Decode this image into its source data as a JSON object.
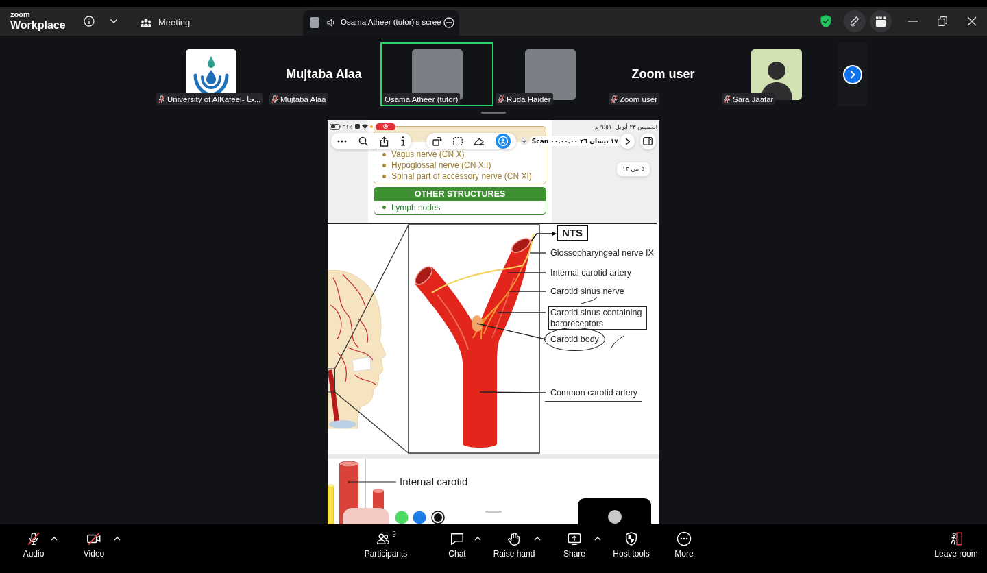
{
  "title_bar": {
    "logo_small": "zoom",
    "logo": "Workplace",
    "tabs": [
      {
        "label": "Meeting",
        "kind": "meeting",
        "selected": false
      },
      {
        "label": "Osama Atheer (tutor)'s scree",
        "kind": "screen_share",
        "selected": true
      }
    ]
  },
  "participants": [
    {
      "kind": "logo",
      "label": "University of AlKafeel- جا...",
      "muted": true,
      "speaking": false
    },
    {
      "kind": "name",
      "display_name": "Mujtaba Alaa",
      "label": "Mujtaba Alaa",
      "muted": true,
      "speaking": false
    },
    {
      "kind": "photo",
      "label": "Osama Atheer (tutor)",
      "muted": false,
      "speaking": true
    },
    {
      "kind": "photo",
      "label": "Ruda Haider",
      "muted": true,
      "speaking": false
    },
    {
      "kind": "name",
      "display_name": "Zoom user",
      "label": "Zoom user",
      "muted": true,
      "speaking": false
    },
    {
      "kind": "avatar",
      "label": "Sara Jaafar",
      "muted": true,
      "speaking": false
    }
  ],
  "shared_screen": {
    "status_bar": {
      "battery": "٦١٪",
      "recording": true,
      "time": "٩:٥١ م",
      "date": "الخميس ٢٣ أبريل"
    },
    "toolbar": {
      "document_title": "Scan ١٧ نيسان ٢٦ ٠٠.٠٠.٠٠",
      "markup_on": true
    },
    "page_indicator": "٥ من ١٣",
    "list_items": [
      "Vagus nerve (CN X)",
      "Hypoglossal nerve (CN XII)",
      "Spinal part of accessory nerve (CN XI)"
    ],
    "other_structures": {
      "title": "OTHER STRUCTURES",
      "items": [
        "Lymph nodes"
      ]
    },
    "diagram": {
      "labels": [
        {
          "text": "NTS",
          "kind": "framed"
        },
        {
          "text": "Glossopharyngeal nerve IX",
          "kind": "plain"
        },
        {
          "text": "Internal carotid artery",
          "kind": "plain"
        },
        {
          "text": "Carotid sinus nerve",
          "kind": "plain"
        },
        {
          "text": "Carotid sinus containing baroreceptors",
          "kind": "boxed"
        },
        {
          "text": "Carotid body",
          "kind": "circled"
        },
        {
          "text": "Common carotid artery",
          "kind": "underlined"
        }
      ]
    },
    "second_figure": {
      "label": "Internal carotid"
    },
    "pen_colors": [
      {
        "color": "#4cd964",
        "selected": false
      },
      {
        "color": "#1e7ce6",
        "selected": false
      },
      {
        "color": "#111111",
        "selected": true
      }
    ]
  },
  "toolbar": {
    "media": [
      {
        "label": "Audio",
        "kind": "audio",
        "muted": true,
        "menu": true
      },
      {
        "label": "Video",
        "kind": "video",
        "muted": true,
        "menu": true
      }
    ],
    "controls": [
      {
        "label": "Participants",
        "kind": "participants",
        "count": "9",
        "menu": false
      },
      {
        "label": "Chat",
        "kind": "chat",
        "menu": true
      },
      {
        "label": "Raise hand",
        "kind": "raise_hand",
        "menu": true
      },
      {
        "label": "Share",
        "kind": "share",
        "menu": true
      },
      {
        "label": "Host tools",
        "kind": "host_tools",
        "menu": false
      },
      {
        "label": "More",
        "kind": "more",
        "menu": false
      }
    ],
    "leave": {
      "label": "Leave room"
    }
  }
}
